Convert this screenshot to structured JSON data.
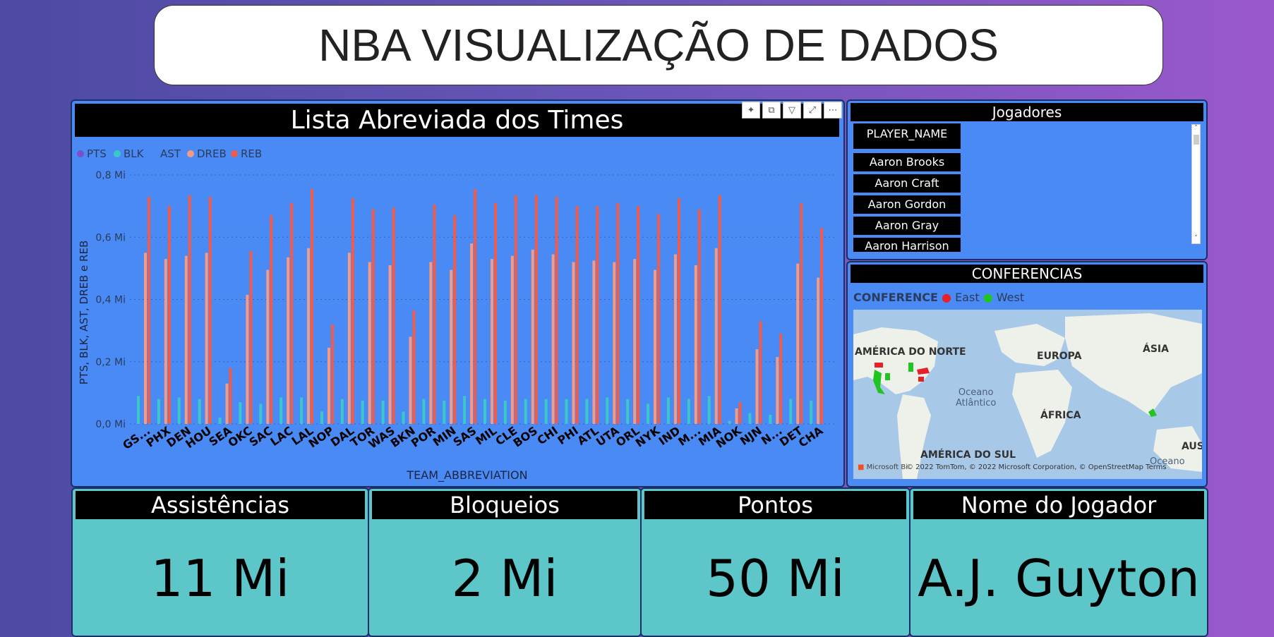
{
  "title": "NBA VISUALIZAÇÃO DE DADOS",
  "chart_panel": {
    "heading": "Lista Abreviada dos Times",
    "tools": [
      "pin-icon",
      "copy-icon",
      "filter-icon",
      "expand-icon",
      "more-icon"
    ]
  },
  "chart_data": {
    "type": "bar",
    "xlabel": "TEAM_ABBREVIATION",
    "ylabel": "PTS, BLK, AST, DREB e REB",
    "yticks": [
      "0,0 Mi",
      "0,2 Mi",
      "0,4 Mi",
      "0,6 Mi",
      "0,8 Mi"
    ],
    "ylim": [
      0,
      0.8
    ],
    "legend": [
      "PTS",
      "BLK",
      "AST",
      "DREB",
      "REB"
    ],
    "colors": {
      "PTS": "#7b4fc9",
      "BLK": "#3cc7c9",
      "AST": "#4a8af4",
      "DREB": "#f59a85",
      "REB": "#f05b4a"
    },
    "categories": [
      "GS...",
      "PHX",
      "DEN",
      "HOU",
      "SEA",
      "OKC",
      "SAC",
      "LAC",
      "LAL",
      "NOP",
      "DAL",
      "TOR",
      "WAS",
      "BKN",
      "POR",
      "MIN",
      "SAS",
      "MIL",
      "CLE",
      "BOS",
      "CHI",
      "PHI",
      "ATL",
      "UTA",
      "ORL",
      "NYK",
      "IND",
      "M...",
      "MIA",
      "NOK",
      "NJN",
      "N...",
      "DET",
      "CHA"
    ],
    "series": [
      {
        "name": "BLK",
        "values": [
          0.09,
          0.08,
          0.085,
          0.08,
          0.02,
          0.07,
          0.065,
          0.085,
          0.085,
          0.04,
          0.08,
          0.075,
          0.075,
          0.04,
          0.08,
          0.075,
          0.09,
          0.08,
          0.075,
          0.08,
          0.08,
          0.08,
          0.08,
          0.085,
          0.08,
          0.065,
          0.085,
          0.08,
          0.09,
          0.01,
          0.035,
          0.03,
          0.08,
          0.075
        ]
      },
      {
        "name": "DREB",
        "values": [
          0.55,
          0.53,
          0.54,
          0.55,
          0.13,
          0.415,
          0.495,
          0.535,
          0.565,
          0.245,
          0.55,
          0.52,
          0.51,
          0.28,
          0.52,
          0.495,
          0.58,
          0.53,
          0.54,
          0.56,
          0.545,
          0.52,
          0.525,
          0.52,
          0.53,
          0.495,
          0.545,
          0.51,
          0.565,
          0.05,
          0.24,
          0.215,
          0.515,
          0.47
        ]
      },
      {
        "name": "REB",
        "values": [
          0.73,
          0.7,
          0.735,
          0.73,
          0.18,
          0.555,
          0.67,
          0.71,
          0.755,
          0.32,
          0.725,
          0.69,
          0.695,
          0.365,
          0.705,
          0.67,
          0.755,
          0.71,
          0.735,
          0.735,
          0.73,
          0.7,
          0.7,
          0.71,
          0.7,
          0.675,
          0.725,
          0.69,
          0.735,
          0.07,
          0.33,
          0.29,
          0.71,
          0.63
        ]
      }
    ]
  },
  "players": {
    "heading": "Jogadores",
    "column": "PLAYER_NAME",
    "items": [
      "Aaron Brooks",
      "Aaron Craft",
      "Aaron Gordon",
      "Aaron Gray",
      "Aaron Harrison"
    ]
  },
  "conferences": {
    "heading": "CONFERENCIAS",
    "legend_title": "CONFERENCE",
    "east": "East",
    "west": "West",
    "east_color": "#e8202a",
    "west_color": "#22c422",
    "labels": {
      "na": "AMÉRICA DO NORTE",
      "eu": "EUROPA",
      "as": "ÁSIA",
      "af": "ÁFRICA",
      "sa": "AMÉRICA DO SUL",
      "au": "AUST",
      "ocean1": "Oceano",
      "ocean1b": "Atlântico",
      "ocean2": "Oceano"
    },
    "attribution": "© 2022 TomTom, © 2022 Microsoft Corporation, © OpenStreetMap  Terms",
    "ms": "Microsoft Bi"
  },
  "kpis": [
    {
      "label": "Assistências",
      "value": "11 Mi"
    },
    {
      "label": "Bloqueios",
      "value": "2 Mi"
    },
    {
      "label": "Pontos",
      "value": "50 Mi"
    },
    {
      "label": "Nome do Jogador",
      "value": "A.J. Guyton"
    }
  ]
}
